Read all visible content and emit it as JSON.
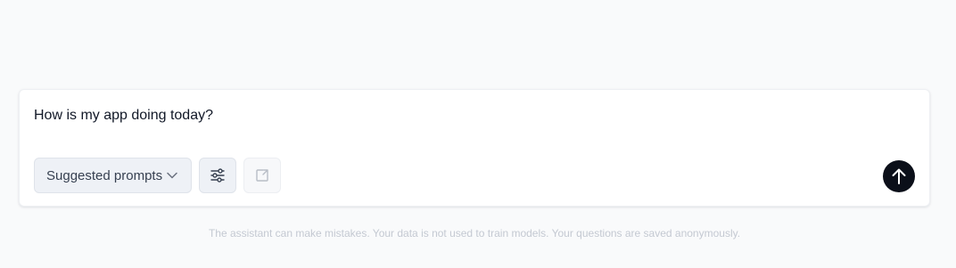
{
  "composer": {
    "input_value": "How is my app doing today?",
    "suggested_prompts_label": "Suggested prompts",
    "icons": {
      "dropdown": "chevron-down-icon",
      "settings": "sliders-icon",
      "expand": "expand-window-icon",
      "send": "arrow-up-icon"
    }
  },
  "footer": {
    "disclaimer": "The assistant can make mistakes. Your data is not used to train models. Your questions are saved anonymously."
  },
  "colors": {
    "send_button": "#0b0f19",
    "toolbar_button_bg": "#eef1f6",
    "disclaimer_text": "#c4c9d2"
  }
}
